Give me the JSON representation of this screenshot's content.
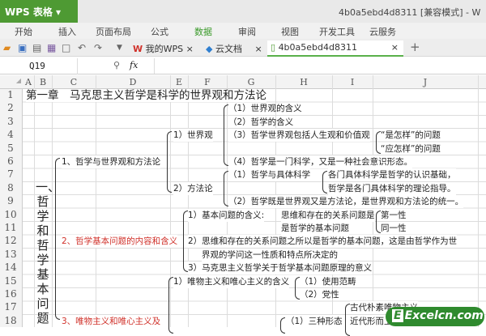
{
  "app": {
    "name": "WPS 表格",
    "doc_title": "4b0a5ebd4d8311 [兼容模式] - W"
  },
  "menu": [
    "开始",
    "插入",
    "页面布局",
    "公式",
    "数据",
    "审阅",
    "视图",
    "开发工具",
    "云服务"
  ],
  "tabs": [
    "我的WPS",
    "云文档",
    "4b0a5ebd4d8311"
  ],
  "formula": {
    "cell": "Q19",
    "fx": "fx",
    "value": ""
  },
  "columns": [
    "A",
    "B",
    "C",
    "D",
    "E",
    "F",
    "G",
    "H",
    "I",
    "J"
  ],
  "rows": [
    "1",
    "2",
    "3",
    "4",
    "5",
    "6",
    "7",
    "8",
    "9",
    "10",
    "11",
    "12",
    "13",
    "14",
    "15",
    "16",
    "17",
    "18"
  ],
  "cells": {
    "title": "第一章　马克思主义哲学是科学的世界观和方法论",
    "r2": "（1）世界观的含义",
    "r3": "（2）哲学的含义",
    "wv": "1）世界观",
    "r4": "（3）哲学世界观包括人生观和价值观",
    "r4b": "“是怎样”的问题",
    "r5b": "“应怎样”的问题",
    "s1": "1、哲学与世界观和方法论",
    "r6": "（4）哲学是一门科学，又是一种社会意识形态。",
    "r7": "（1）哲学与具体科学",
    "r7b": "各门具体科学是哲学的认识基础，",
    "r8b": "哲学是各门具体科学的理论指导。",
    "mm": "2）方法论",
    "r9": "（2）哲学既是世界观又是方法论，是世界观和方法论的统一。",
    "vertical": "一、哲学和哲学基本问题",
    "r10": "1）基本问题的含义:",
    "r10b": "思维和存在的关系问题是",
    "r11b": "是哲学的基本问题",
    "r10c": "第一性",
    "r11c": "同一性",
    "s2": "2、哲学基本问题的内容和含义",
    "r12": "2）思维和存在的关系问题之所以是哲学的基本问题，这是由哲学作为世",
    "r13": "界观的学问这一性质和特点所决定的",
    "r14": "3）马克思主义哲学关于哲学基本问题原理的意义",
    "r15": "1）唯物主义和唯心主义的含义",
    "r15b": "（1）使用范畴",
    "r16b": "（2）党性",
    "r17": "古代朴素唯物主义",
    "r18b": "近代形而上",
    "r18": "（1）三种形态",
    "s3": "3、唯物主义和唯心主义及"
  },
  "watermark": "Excelcn.com"
}
